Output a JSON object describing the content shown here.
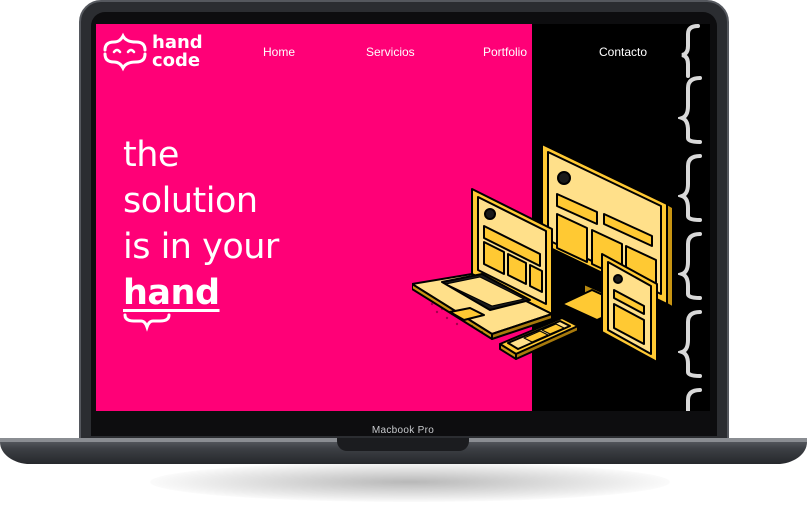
{
  "device": {
    "model_label": "Macbook Pro"
  },
  "site": {
    "logo": {
      "line1": "hand",
      "line2": "code"
    },
    "nav": [
      {
        "label": "Home"
      },
      {
        "label": "Servicios"
      },
      {
        "label": "Portfolio"
      },
      {
        "label": "Contacto"
      }
    ],
    "hero": {
      "line1": "the",
      "line2": "solution",
      "line3": "is in your",
      "line4": "hand"
    }
  },
  "colors": {
    "primary": "#ff0077",
    "dark": "#000000",
    "accent": "#ffc933",
    "text": "#ffffff"
  }
}
